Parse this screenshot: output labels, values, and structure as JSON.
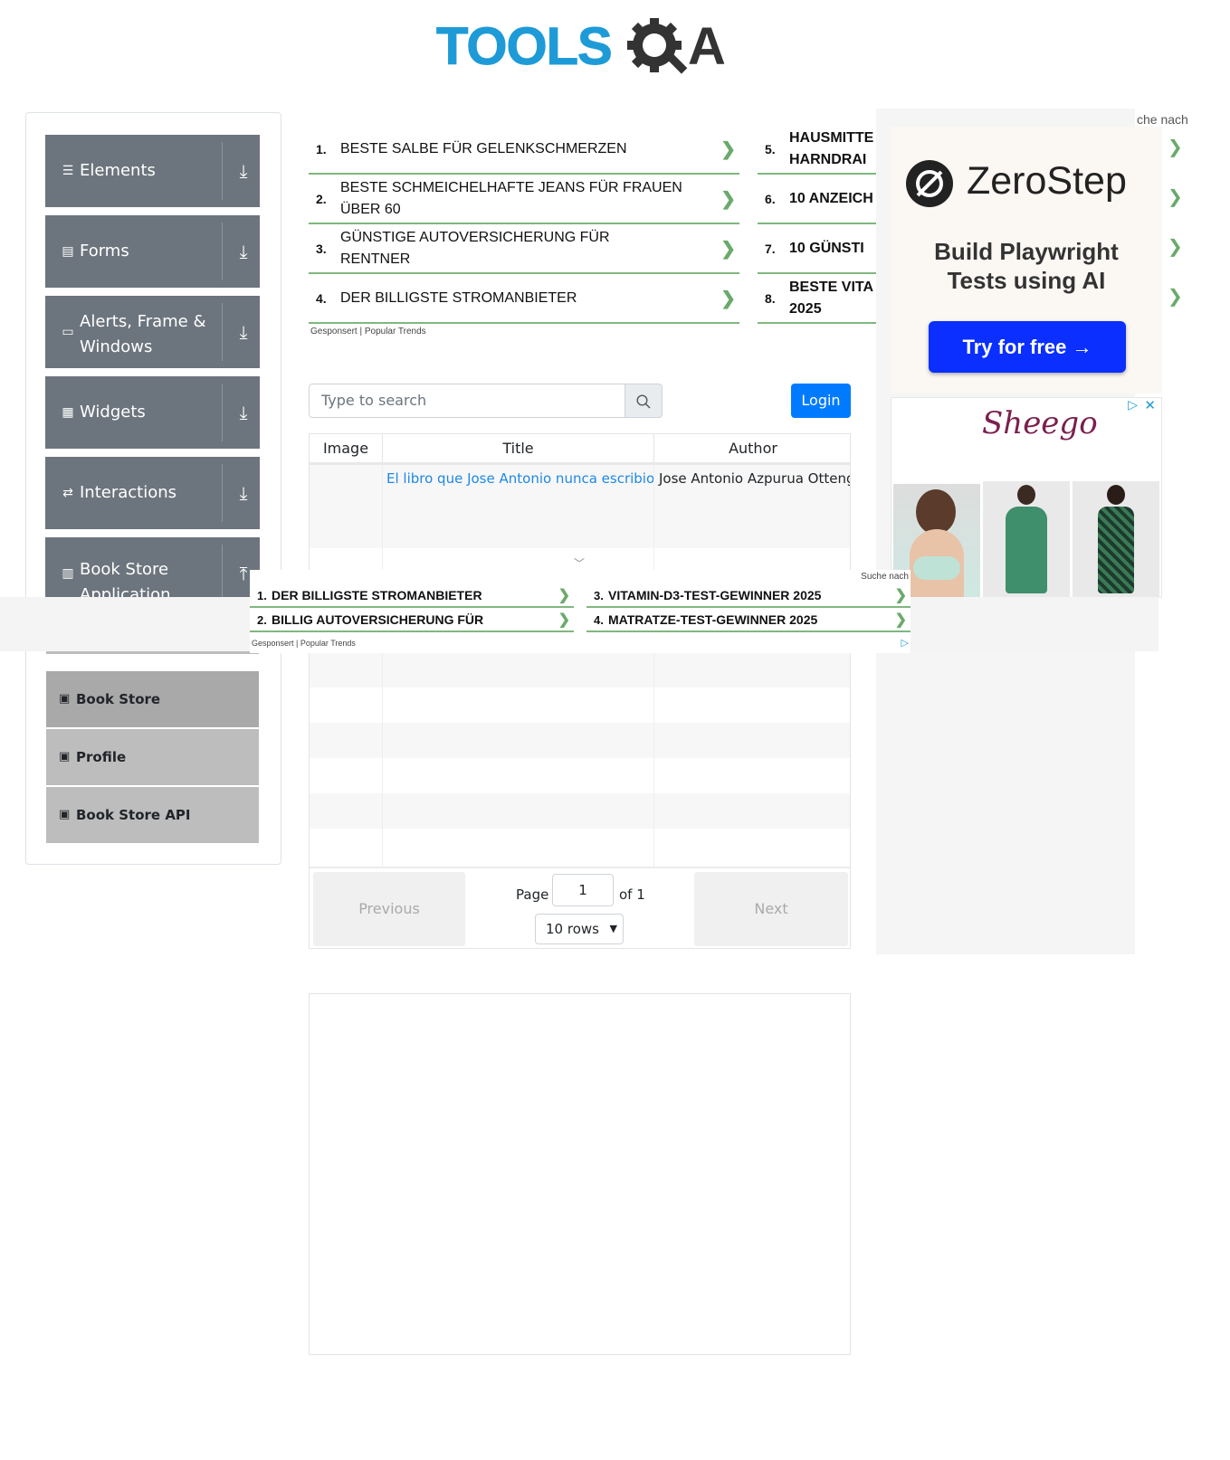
{
  "logo": {
    "text_tools": "TOOLS",
    "text_a": "A"
  },
  "sidebar": {
    "groups": [
      {
        "label": "Elements",
        "icon": "menu-icon"
      },
      {
        "label": "Forms",
        "icon": "document-icon"
      },
      {
        "label": "Alerts, Frame & Windows",
        "icon": "window-icon"
      },
      {
        "label": "Widgets",
        "icon": "widgets-icon"
      },
      {
        "label": "Interactions",
        "icon": "interactions-icon"
      },
      {
        "label": "Book Store Application",
        "icon": "books-icon"
      }
    ],
    "items": [
      {
        "label": "Book Store"
      },
      {
        "label": "Profile"
      },
      {
        "label": "Book Store API"
      }
    ]
  },
  "ad_top": {
    "left": [
      {
        "num": "1.",
        "text": "BESTE SALBE FÜR GELENKSCHMERZEN"
      },
      {
        "num": "2.",
        "text": "BESTE SCHMEICHELHAFTE JEANS FÜR FRAUEN ÜBER 60"
      },
      {
        "num": "3.",
        "text": "GÜNSTIGE AUTOVERSICHERUNG FÜR RENTNER"
      },
      {
        "num": "4.",
        "text": "DER BILLIGSTE STROMANBIETER"
      }
    ],
    "right": [
      {
        "num": "5.",
        "text": "HAUSMITTE HARNDRAI"
      },
      {
        "num": "6.",
        "text": "10 ANZEICH"
      },
      {
        "num": "7.",
        "text": "10 GÜNSTI"
      },
      {
        "num": "8.",
        "text": "BESTE VITA 2025"
      }
    ],
    "footer": "Gesponsert | Popular Trends",
    "suche": "che nach"
  },
  "ad_overlay": {
    "items": [
      {
        "num": "1.",
        "text": "DER BILLIGSTE STROMANBIETER"
      },
      {
        "num": "2.",
        "text": "BILLIG AUTOVERSICHERUNG FÜR"
      },
      {
        "num": "3.",
        "text": "VITAMIN-D3-TEST-GEWINNER 2025"
      },
      {
        "num": "4.",
        "text": "MATRATZE-TEST-GEWINNER 2025"
      }
    ],
    "footer": "Gesponsert | Popular Trends",
    "suche": "Suche nach"
  },
  "ad_zerostep": {
    "brand": "ZeroStep",
    "headline": "Build Playwright Tests using AI",
    "cta": "Try for free →"
  },
  "ad_sheego": {
    "brand": "Sheego"
  },
  "search": {
    "placeholder": "Type to search"
  },
  "login_label": "Login",
  "table": {
    "headers": [
      "Image",
      "Title",
      "Author"
    ],
    "rows": [
      {
        "title": "El libro que Jose Antonio nunca escribio",
        "author": "Jose Antonio Azpurua Ottengo"
      }
    ]
  },
  "pagination": {
    "previous": "Previous",
    "next": "Next",
    "page_label": "Page",
    "page_value": "1",
    "of_label": "of 1",
    "rows_option": "10 rows"
  },
  "colors": {
    "sidebar_group": "#6c757d",
    "accent": "#007bff",
    "link": "#1e88e5",
    "ad_green": "#7fb77e"
  }
}
